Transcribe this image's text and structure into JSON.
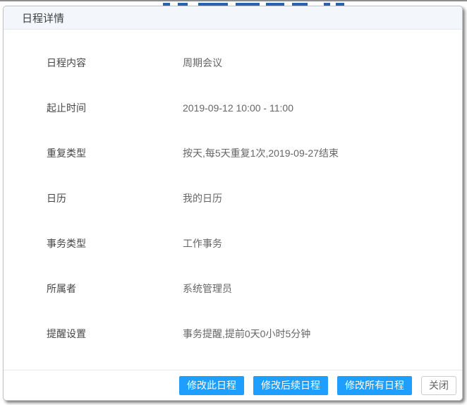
{
  "dialog": {
    "title": "日程详情",
    "fields": [
      {
        "label": "日程内容",
        "value": "周期会议"
      },
      {
        "label": "起止时间",
        "value": "2019-09-12 10:00 - 11:00"
      },
      {
        "label": "重复类型",
        "value": "按天,每5天重复1次,2019-09-27结束"
      },
      {
        "label": "日历",
        "value": "我的日历"
      },
      {
        "label": "事务类型",
        "value": "工作事务"
      },
      {
        "label": "所属者",
        "value": "系统管理员"
      },
      {
        "label": "提醒设置",
        "value": "事务提醒,提前0天0小时5分钟"
      }
    ],
    "buttons": {
      "modify_this": "修改此日程",
      "modify_following": "修改后续日程",
      "modify_all": "修改所有日程",
      "close": "关闭"
    }
  },
  "colors": {
    "primary_button": "#1E9FFF",
    "header_bg": "#f3f7fc",
    "title_text": "#3f3f3f",
    "label_text": "#464646",
    "value_text": "#666666",
    "background_accent": "#2a62b0"
  }
}
